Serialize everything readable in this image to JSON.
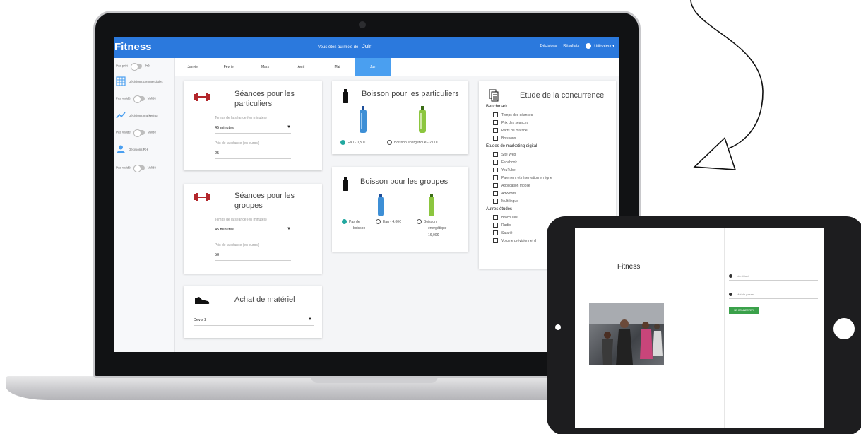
{
  "app": {
    "title": "Fitness",
    "month_prefix": "Vous êtes au mois de - ",
    "month_name": "Juin",
    "nav": [
      "Décisions",
      "Résultats",
      "Utilisateur"
    ],
    "colors": {
      "primary": "#2b79dd",
      "tab_active": "#4a9ff0",
      "radio_on": "#22a8a0",
      "accent_red": "#b3262b"
    }
  },
  "sidebar": {
    "top_toggle": {
      "left": "Pas prêt",
      "right": "Prêt"
    },
    "items": [
      {
        "icon": "table-icon",
        "label": "Décisions commerciales",
        "toggle_left": "Pas validé",
        "toggle_right": "Validé"
      },
      {
        "icon": "trend-up-icon",
        "label": "Décisions marketing",
        "toggle_left": "Pas validé",
        "toggle_right": "Validé"
      },
      {
        "icon": "user-icon",
        "label": "Décisions RH",
        "toggle_left": "Pas validé",
        "toggle_right": "Validé"
      }
    ]
  },
  "tabs": [
    {
      "label": "Janvier",
      "active": false
    },
    {
      "label": "Février",
      "active": false
    },
    {
      "label": "Mars",
      "active": false
    },
    {
      "label": "Avril",
      "active": false
    },
    {
      "label": "Mai",
      "active": false
    },
    {
      "label": "Juin",
      "active": true
    }
  ],
  "cards": {
    "particuliers": {
      "title_line1": "Séances pour les",
      "title_line2": "particuliers",
      "duration_label": "Temps de la séance (en minutes)",
      "duration_value": "45 minutes",
      "price_label": "Prix de la séance (en euros)",
      "price_value": "25"
    },
    "groupes": {
      "title_line1": "Séances pour les",
      "title_line2": "groupes",
      "duration_label": "Temps de la séance (en minutes)",
      "duration_value": "45 minutes",
      "price_label": "Prix de la séance (en euros)",
      "price_value": "50"
    },
    "materiel": {
      "title": "Achat de matériel",
      "select_value": "Devis 2"
    },
    "boisson_particuliers": {
      "title": "Boisson pour les particuliers",
      "options": [
        "Eau - 0,50€",
        "Boisson énergétique - 2,00€"
      ],
      "selected": 0
    },
    "boisson_groupes": {
      "title": "Boisson pour les groupes",
      "option1_line1": "Pas de",
      "option1_line2": "boisson",
      "option2": "Eau - 4,00€",
      "option3_line1": "Boisson",
      "option3_line2": "énergétique -",
      "option3_line3": "16,00€",
      "selected": 0
    },
    "concurrence": {
      "title": "Etude de la concurrence",
      "sections": [
        {
          "heading": "Benchmark",
          "items": [
            "Temps des séances",
            "Prix des séances",
            "Parts de marché",
            "Boissons"
          ]
        },
        {
          "heading": "Etudes de marketing digital",
          "items": [
            "Site Web",
            "Facebook",
            "YouTube",
            "Paiement et réservation en ligne",
            "Application mobile",
            "AdWords",
            "Multilingue"
          ]
        },
        {
          "heading": "Autres études",
          "items": [
            "Brochures",
            "Radio",
            "Salarié",
            "Volume prévisionnel d"
          ]
        }
      ]
    }
  },
  "tablet": {
    "title": "Fitness",
    "field1": "Identifiant",
    "field2": "Mot de passe",
    "login_button": "SE CONNECTER"
  }
}
